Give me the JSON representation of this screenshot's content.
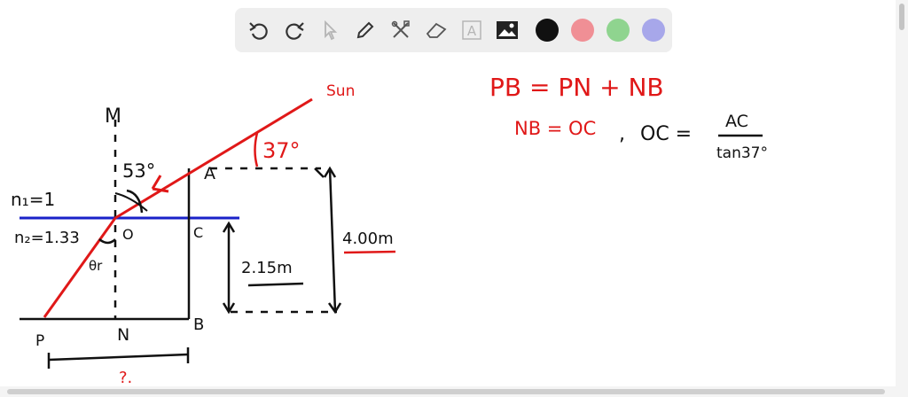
{
  "toolbar": {
    "tools": [
      {
        "name": "undo-icon"
      },
      {
        "name": "redo-icon"
      },
      {
        "name": "pointer-icon"
      },
      {
        "name": "pen-icon"
      },
      {
        "name": "tools-icon"
      },
      {
        "name": "eraser-icon"
      },
      {
        "name": "text-icon",
        "glyph": "A"
      },
      {
        "name": "image-icon"
      }
    ],
    "colors": [
      "#111111",
      "#f08f95",
      "#8fd48f",
      "#a7a7ea"
    ]
  },
  "diagram": {
    "sun_label": "Sun",
    "angle_top": "37°",
    "angle_incident": "53°",
    "point_M": "M",
    "point_A": "A",
    "point_O": "O",
    "point_C": "C",
    "point_B": "B",
    "point_N": "N",
    "point_P": "P",
    "n1": "n₁=1",
    "n2": "n₂=1.33",
    "theta_r": "θr",
    "height_total": "4.00m",
    "height_water": "2.15m",
    "unknown": "?."
  },
  "notes": {
    "line1": "PB = PN + NB",
    "line2_left": "NB = OC",
    "line2_sep": ",",
    "line2_mid": "OC =",
    "frac_num": "AC",
    "frac_den": "tan37°"
  }
}
